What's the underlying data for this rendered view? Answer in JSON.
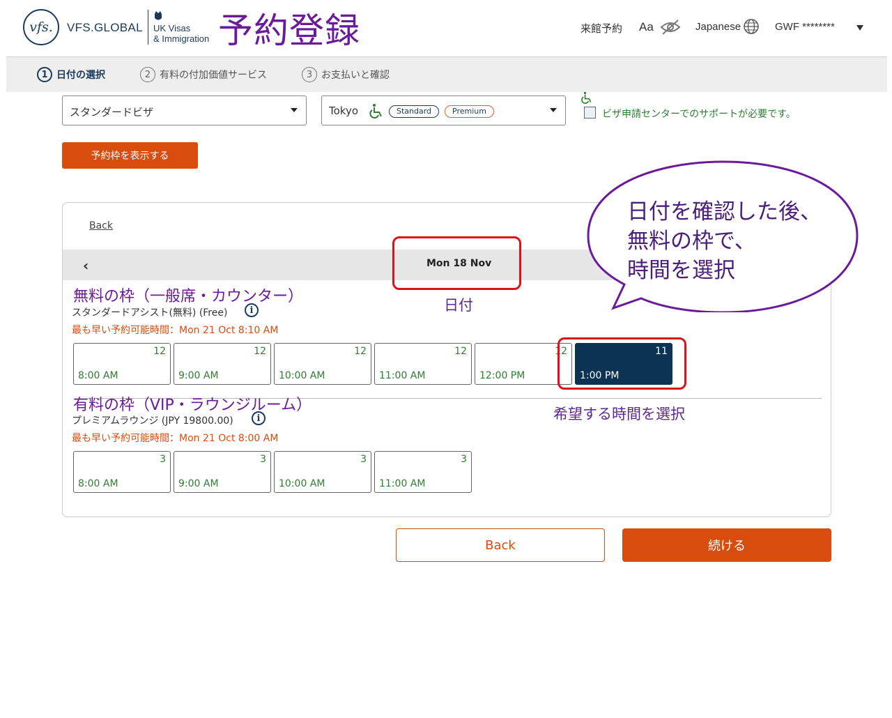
{
  "header": {
    "logo_circle": "vfs.",
    "brand": "VFS.GLOBAL",
    "partner_line1": "UK Visas",
    "partner_line2": "& Immigration",
    "page_title": "予約登録",
    "nav_booking": "来館予約",
    "font_size_label": "Aa",
    "language": "Japanese",
    "user": "GWF ********",
    "icons": [
      "eye-off-icon",
      "globe-icon",
      "caret-down-icon"
    ]
  },
  "steps": [
    {
      "num": "1",
      "label": "日付の選択",
      "active": true
    },
    {
      "num": "2",
      "label": "有料の付加価値サービス",
      "active": false
    },
    {
      "num": "3",
      "label": "お支払いと確認",
      "active": false
    }
  ],
  "form": {
    "visa_type": "スタンダードビザ",
    "centre": "Tokyo",
    "pill_standard": "Standard",
    "pill_premium": "Premium",
    "support_label": "ビザ申請センターでのサポートが必要です。",
    "show_slots_button": "予約枠を表示する"
  },
  "panel": {
    "back_link": "Back",
    "date": "Mon 18 Nov",
    "free_section": {
      "title": "無料の枠（一般席・カウンター）",
      "subtitle": "スタンダードアシスト(無料) (Free)",
      "earliest": "最も早い予約可能時間：Mon 21 Oct 8:10 AM",
      "slots": [
        {
          "count": "12",
          "time": "8:00 AM"
        },
        {
          "count": "12",
          "time": "9:00 AM"
        },
        {
          "count": "12",
          "time": "10:00 AM"
        },
        {
          "count": "12",
          "time": "11:00 AM"
        },
        {
          "count": "12",
          "time": "12:00 PM"
        },
        {
          "count": "11",
          "time": "1:00 PM"
        }
      ]
    },
    "premium_section": {
      "title": "有料の枠（VIP・ラウンジルーム）",
      "subtitle": "プレミアムラウンジ (JPY 19800.00)",
      "earliest": "最も早い予約可能時間：Mon 21 Oct 8:00 AM",
      "slots": [
        {
          "count": "3",
          "time": "8:00 AM"
        },
        {
          "count": "3",
          "time": "9:00 AM"
        },
        {
          "count": "3",
          "time": "10:00 AM"
        },
        {
          "count": "3",
          "time": "11:00 AM"
        }
      ]
    }
  },
  "footer": {
    "back_button": "Back",
    "continue_button": "続ける"
  },
  "annotations": {
    "date_label": "日付",
    "time_label": "希望する時間を選択",
    "bubble_line1": "日付を確認した後、",
    "bubble_line2": "無料の枠で、",
    "bubble_line3": "時間を選択"
  },
  "colors": {
    "brand_navy": "#1b3a5b",
    "accent_orange": "#d84c0e",
    "title_purple": "#6a1b9a",
    "available_green": "#2e7d32",
    "selected_slot": "#0d3354",
    "annotation_red": "#e0101a"
  }
}
